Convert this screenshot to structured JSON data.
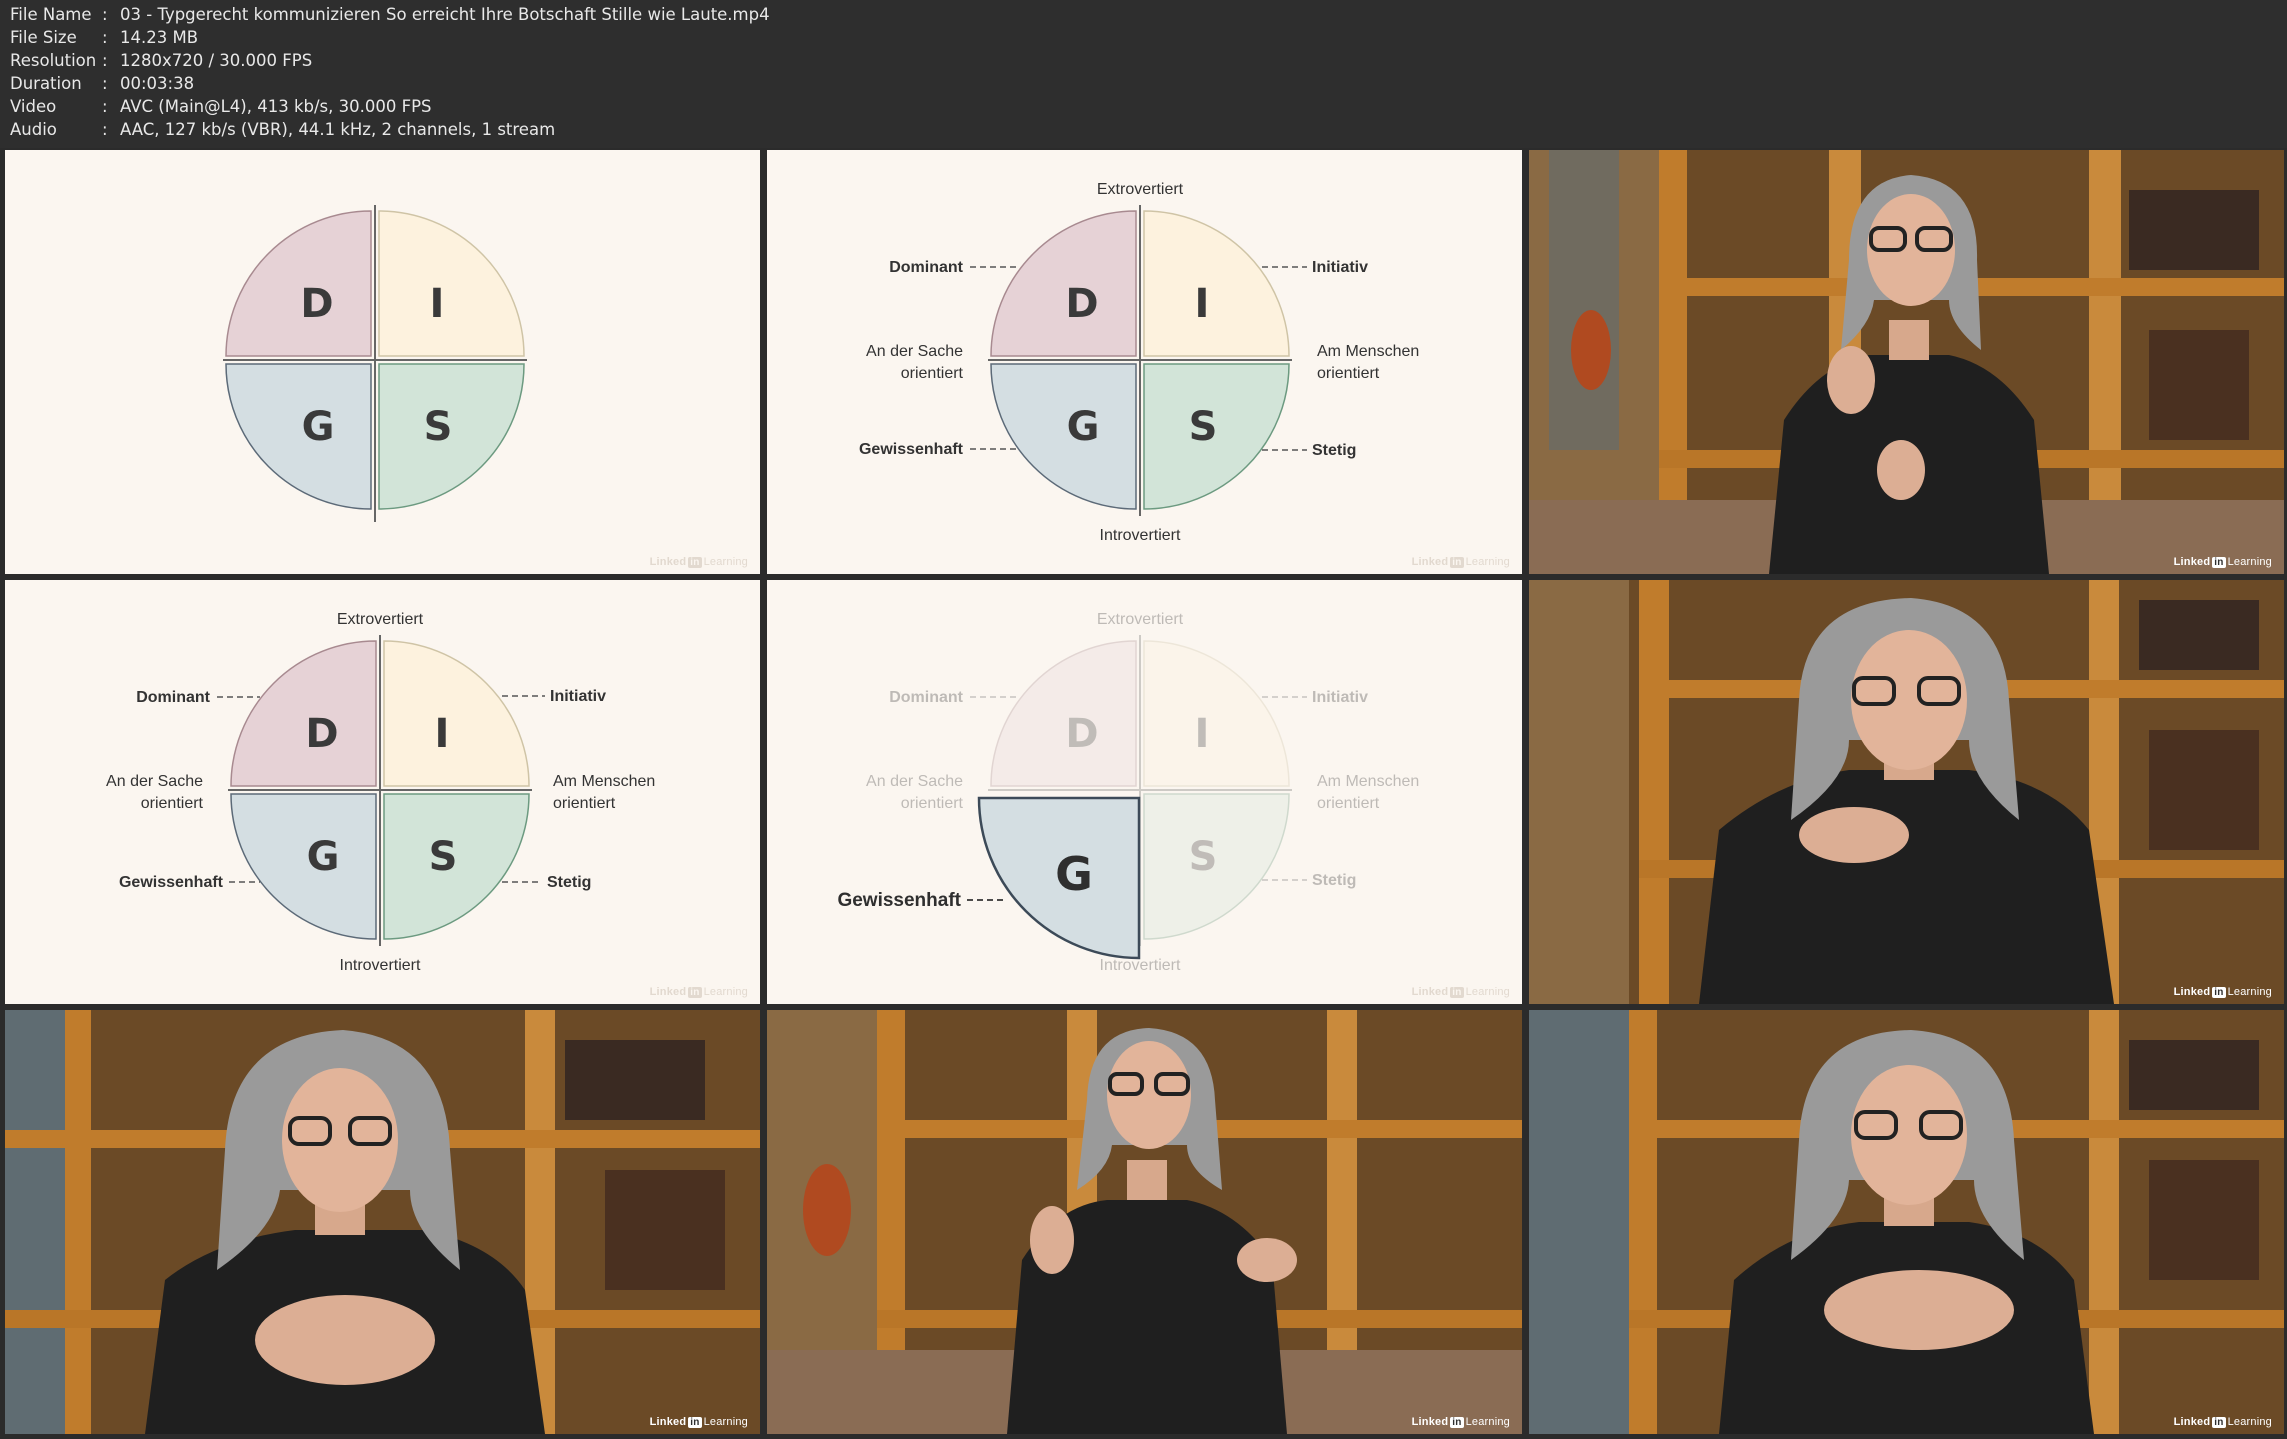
{
  "meta": [
    {
      "key": "File Name",
      "value": "03 - Typgerecht kommunizieren So erreicht Ihre Botschaft Stille wie Laute.mp4"
    },
    {
      "key": "File Size",
      "value": "14.23 MB"
    },
    {
      "key": "Resolution",
      "value": "1280x720 / 30.000 FPS"
    },
    {
      "key": "Duration",
      "value": "00:03:38"
    },
    {
      "key": "Video",
      "value": "AVC (Main@L4), 413 kb/s, 30.000 FPS"
    },
    {
      "key": "Audio",
      "value": "AAC, 127 kb/s (VBR), 44.1 kHz, 2 channels, 1 stream"
    }
  ],
  "separator": ":",
  "disc": {
    "letters": {
      "d": "D",
      "i": "I",
      "g": "G",
      "s": "S"
    },
    "top": "Extrovertiert",
    "bottom": "Introvertiert",
    "left": [
      "An der Sache",
      "orientiert"
    ],
    "right": [
      "Am Menschen",
      "orientiert"
    ],
    "dominant": "Dominant",
    "initiativ": "Initiativ",
    "gewissenhaft": "Gewissenhaft",
    "stetig": "Stetig"
  },
  "colors": {
    "d": "#e6d2d6",
    "i": "#fdf2de",
    "g": "#d4dee2",
    "s": "#d2e4d8",
    "d_stroke": "#a88a90",
    "i_stroke": "#cfc4a6",
    "g_stroke": "#5c6a78",
    "s_stroke": "#6c9a80",
    "slide_bg": "#fbf6f0"
  },
  "watermark": {
    "brand": "Linked",
    "in": "in",
    "product": "Learning"
  }
}
